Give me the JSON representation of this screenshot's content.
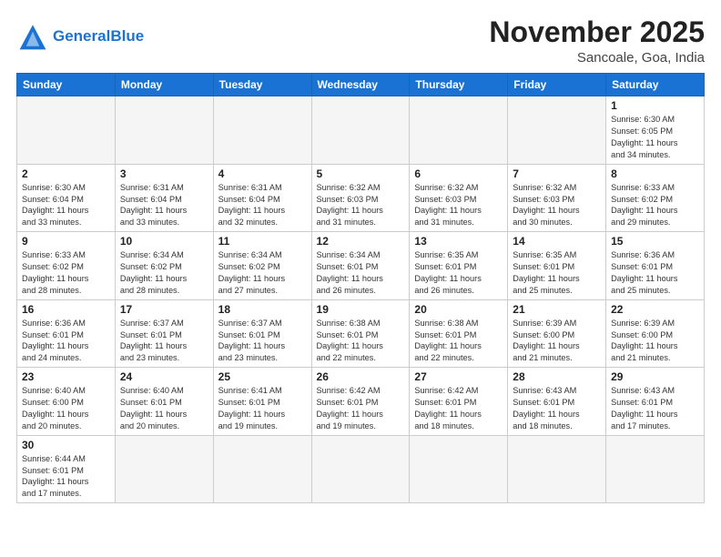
{
  "header": {
    "logo_general": "General",
    "logo_blue": "Blue",
    "month_title": "November 2025",
    "subtitle": "Sancoale, Goa, India"
  },
  "days_of_week": [
    "Sunday",
    "Monday",
    "Tuesday",
    "Wednesday",
    "Thursday",
    "Friday",
    "Saturday"
  ],
  "weeks": [
    [
      {
        "day": "",
        "info": ""
      },
      {
        "day": "",
        "info": ""
      },
      {
        "day": "",
        "info": ""
      },
      {
        "day": "",
        "info": ""
      },
      {
        "day": "",
        "info": ""
      },
      {
        "day": "",
        "info": ""
      },
      {
        "day": "1",
        "info": "Sunrise: 6:30 AM\nSunset: 6:05 PM\nDaylight: 11 hours\nand 34 minutes."
      }
    ],
    [
      {
        "day": "2",
        "info": "Sunrise: 6:30 AM\nSunset: 6:04 PM\nDaylight: 11 hours\nand 33 minutes."
      },
      {
        "day": "3",
        "info": "Sunrise: 6:31 AM\nSunset: 6:04 PM\nDaylight: 11 hours\nand 33 minutes."
      },
      {
        "day": "4",
        "info": "Sunrise: 6:31 AM\nSunset: 6:04 PM\nDaylight: 11 hours\nand 32 minutes."
      },
      {
        "day": "5",
        "info": "Sunrise: 6:32 AM\nSunset: 6:03 PM\nDaylight: 11 hours\nand 31 minutes."
      },
      {
        "day": "6",
        "info": "Sunrise: 6:32 AM\nSunset: 6:03 PM\nDaylight: 11 hours\nand 31 minutes."
      },
      {
        "day": "7",
        "info": "Sunrise: 6:32 AM\nSunset: 6:03 PM\nDaylight: 11 hours\nand 30 minutes."
      },
      {
        "day": "8",
        "info": "Sunrise: 6:33 AM\nSunset: 6:02 PM\nDaylight: 11 hours\nand 29 minutes."
      }
    ],
    [
      {
        "day": "9",
        "info": "Sunrise: 6:33 AM\nSunset: 6:02 PM\nDaylight: 11 hours\nand 28 minutes."
      },
      {
        "day": "10",
        "info": "Sunrise: 6:34 AM\nSunset: 6:02 PM\nDaylight: 11 hours\nand 28 minutes."
      },
      {
        "day": "11",
        "info": "Sunrise: 6:34 AM\nSunset: 6:02 PM\nDaylight: 11 hours\nand 27 minutes."
      },
      {
        "day": "12",
        "info": "Sunrise: 6:34 AM\nSunset: 6:01 PM\nDaylight: 11 hours\nand 26 minutes."
      },
      {
        "day": "13",
        "info": "Sunrise: 6:35 AM\nSunset: 6:01 PM\nDaylight: 11 hours\nand 26 minutes."
      },
      {
        "day": "14",
        "info": "Sunrise: 6:35 AM\nSunset: 6:01 PM\nDaylight: 11 hours\nand 25 minutes."
      },
      {
        "day": "15",
        "info": "Sunrise: 6:36 AM\nSunset: 6:01 PM\nDaylight: 11 hours\nand 25 minutes."
      }
    ],
    [
      {
        "day": "16",
        "info": "Sunrise: 6:36 AM\nSunset: 6:01 PM\nDaylight: 11 hours\nand 24 minutes."
      },
      {
        "day": "17",
        "info": "Sunrise: 6:37 AM\nSunset: 6:01 PM\nDaylight: 11 hours\nand 23 minutes."
      },
      {
        "day": "18",
        "info": "Sunrise: 6:37 AM\nSunset: 6:01 PM\nDaylight: 11 hours\nand 23 minutes."
      },
      {
        "day": "19",
        "info": "Sunrise: 6:38 AM\nSunset: 6:01 PM\nDaylight: 11 hours\nand 22 minutes."
      },
      {
        "day": "20",
        "info": "Sunrise: 6:38 AM\nSunset: 6:01 PM\nDaylight: 11 hours\nand 22 minutes."
      },
      {
        "day": "21",
        "info": "Sunrise: 6:39 AM\nSunset: 6:00 PM\nDaylight: 11 hours\nand 21 minutes."
      },
      {
        "day": "22",
        "info": "Sunrise: 6:39 AM\nSunset: 6:00 PM\nDaylight: 11 hours\nand 21 minutes."
      }
    ],
    [
      {
        "day": "23",
        "info": "Sunrise: 6:40 AM\nSunset: 6:00 PM\nDaylight: 11 hours\nand 20 minutes."
      },
      {
        "day": "24",
        "info": "Sunrise: 6:40 AM\nSunset: 6:01 PM\nDaylight: 11 hours\nand 20 minutes."
      },
      {
        "day": "25",
        "info": "Sunrise: 6:41 AM\nSunset: 6:01 PM\nDaylight: 11 hours\nand 19 minutes."
      },
      {
        "day": "26",
        "info": "Sunrise: 6:42 AM\nSunset: 6:01 PM\nDaylight: 11 hours\nand 19 minutes."
      },
      {
        "day": "27",
        "info": "Sunrise: 6:42 AM\nSunset: 6:01 PM\nDaylight: 11 hours\nand 18 minutes."
      },
      {
        "day": "28",
        "info": "Sunrise: 6:43 AM\nSunset: 6:01 PM\nDaylight: 11 hours\nand 18 minutes."
      },
      {
        "day": "29",
        "info": "Sunrise: 6:43 AM\nSunset: 6:01 PM\nDaylight: 11 hours\nand 17 minutes."
      }
    ],
    [
      {
        "day": "30",
        "info": "Sunrise: 6:44 AM\nSunset: 6:01 PM\nDaylight: 11 hours\nand 17 minutes."
      },
      {
        "day": "",
        "info": ""
      },
      {
        "day": "",
        "info": ""
      },
      {
        "day": "",
        "info": ""
      },
      {
        "day": "",
        "info": ""
      },
      {
        "day": "",
        "info": ""
      },
      {
        "day": "",
        "info": ""
      }
    ]
  ]
}
